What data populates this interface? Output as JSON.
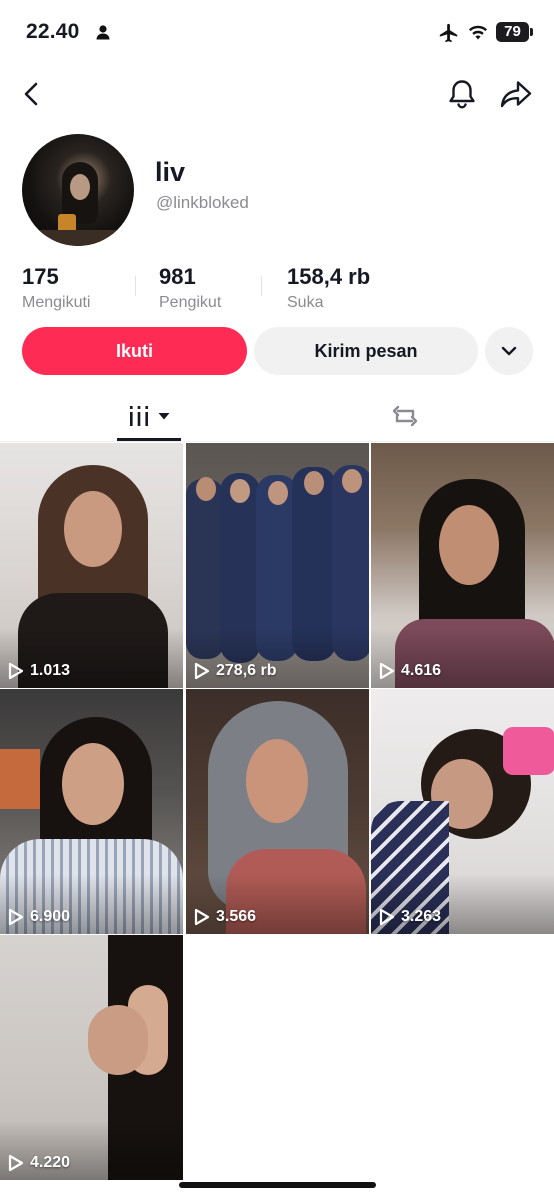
{
  "status_bar": {
    "time": "22.40",
    "battery": "79"
  },
  "profile": {
    "display_name": "liv",
    "username": "@linkbloked",
    "stats": [
      {
        "value": "175",
        "label": "Mengikuti"
      },
      {
        "value": "981",
        "label": "Pengikut"
      },
      {
        "value": "158,4 rb",
        "label": "Suka"
      }
    ]
  },
  "actions": {
    "follow": "Ikuti",
    "message": "Kirim pesan"
  },
  "tabs": [
    {
      "icon": "grid-icon",
      "selected": true
    },
    {
      "icon": "repost-icon",
      "selected": false
    }
  ],
  "videos": [
    {
      "views": "1.013"
    },
    {
      "views": "278,6 rb"
    },
    {
      "views": "4.616"
    },
    {
      "views": "6.900"
    },
    {
      "views": "3.566"
    },
    {
      "views": "3.263"
    },
    {
      "views": "4.220"
    }
  ],
  "colors": {
    "accent": "#fe2c55",
    "secondary_button": "#f1f1f2",
    "text_primary": "#161823",
    "text_secondary": "#8a8b91"
  }
}
